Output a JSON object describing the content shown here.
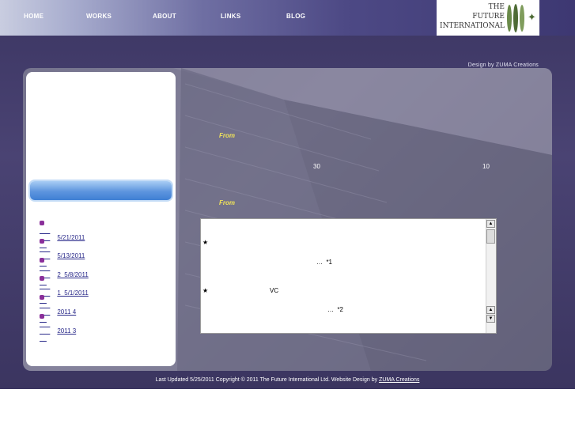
{
  "nav": {
    "items": [
      "HOME",
      "WORKS",
      "ABOUT",
      "LINKS",
      "BLOG"
    ]
  },
  "logo": {
    "lines": [
      "THE",
      "FUTURE",
      "INTERNATIONAL"
    ]
  },
  "design_credit": "Design by ZUMA Creations",
  "sidebar": {
    "links": [
      "5/21/2011",
      "5/13/2011",
      "2  5/8/2011",
      "1  5/1/2011",
      "2011 4",
      "2011 3"
    ]
  },
  "main": {
    "from_label_1": "From",
    "number_1": "30",
    "number_2": "10",
    "from_label_2": "From",
    "textbox": {
      "line1": "★",
      "line2": "…  *1",
      "line3_star": "★",
      "line3_text": "VC",
      "line4": "…  *2"
    }
  },
  "footer": {
    "text": "Last Updated 5/25/2011  Copyright © 2011 The Future International Ltd.   Website Design by",
    "link": "ZUMA Creations"
  },
  "colors": {
    "accent_yellow": "#f0e35a",
    "link_purple": "#8a2f9a",
    "logo_green": "#4e6b35"
  }
}
